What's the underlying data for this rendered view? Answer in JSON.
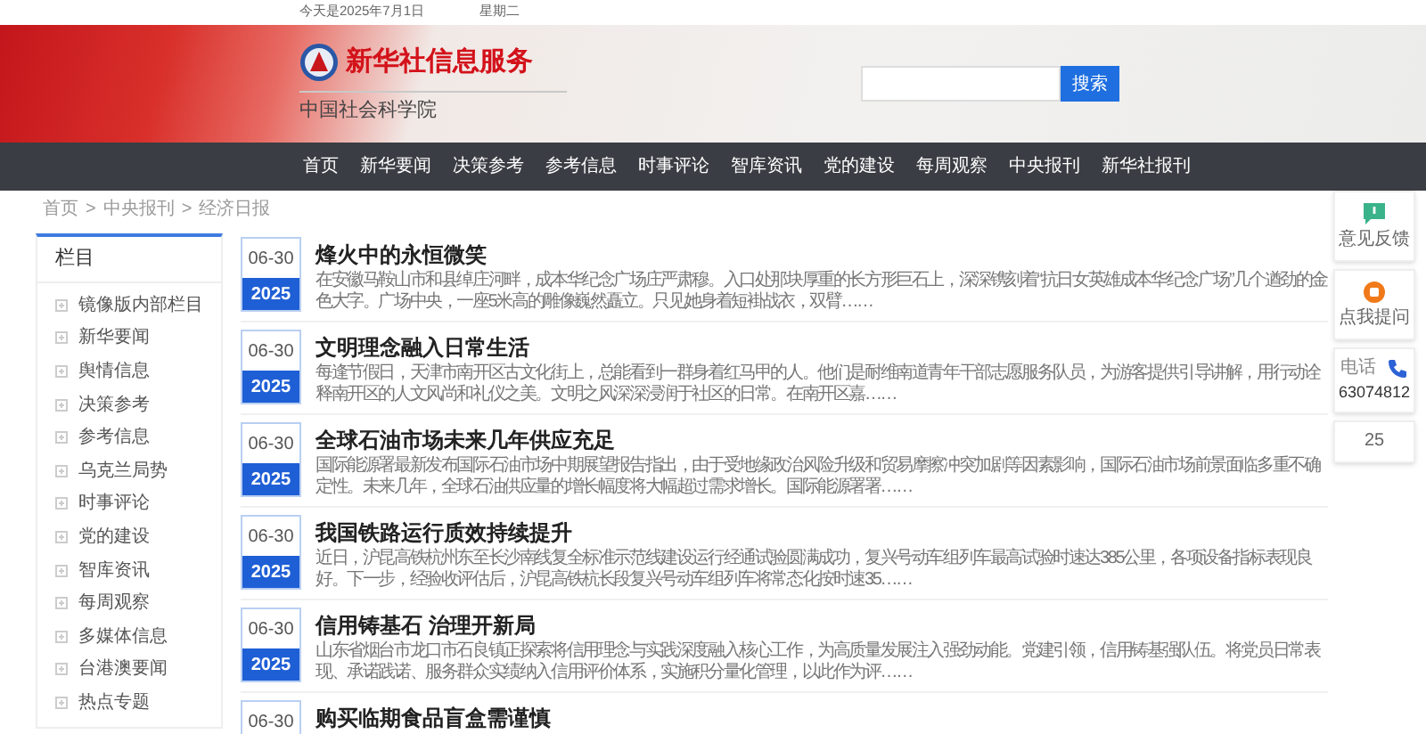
{
  "top_bar": {
    "date": "今天是2025年7月1日",
    "weekday": "星期二"
  },
  "header": {
    "brand": "新华社信息服务",
    "org": "中国社会科学院",
    "search": {
      "button": "搜索"
    }
  },
  "nav": [
    "首页",
    "新华要闻",
    "决策参考",
    "参考信息",
    "时事评论",
    "智库资讯",
    "党的建设",
    "每周观察",
    "中央报刊",
    "新华社报刊"
  ],
  "breadcrumb": {
    "separator": ">",
    "items": [
      "首页",
      "中央报刊",
      "经济日报"
    ]
  },
  "sidebar": {
    "title": "栏目",
    "items": [
      "镜像版内部栏目",
      "新华要闻",
      "舆情信息",
      "决策参考",
      "参考信息",
      "乌克兰局势",
      "时事评论",
      "党的建设",
      "智库资讯",
      "每周观察",
      "多媒体信息",
      "台港澳要闻",
      "热点专题"
    ]
  },
  "articles": [
    {
      "date": "06-30",
      "year": "2025",
      "title": "烽火中的永恒微笑",
      "summary": "在安徽马鞍山市和县绰庄河畔，成本华纪念广场庄严肃穆。入口处那块厚重的长方形巨石上，深深镌刻着“抗日女英雄成本华纪念广场”几个遒劲的金色大字。广场中央，一座5米高的雕像巍然矗立。只见她身着短褂战衣，双臂……"
    },
    {
      "date": "06-30",
      "year": "2025",
      "title": "文明理念融入日常生活",
      "summary": "每逢节假日，天津市南开区古文化街上，总能看到一群身着红马甲的人。他们是耐维南道青年干部志愿服务队员，为游客提供引导讲解，用行动诠释南开区的人文风尚和礼仪之美。文明之风深深浸润于社区的日常。在南开区嘉……"
    },
    {
      "date": "06-30",
      "year": "2025",
      "title": "全球石油市场未来几年供应充足",
      "summary": "国际能源署最新发布国际石油市场中期展望报告指出，由于受地缘政治风险升级和贸易摩擦冲突加剧等因素影响，国际石油市场前景面临多重不确定性。未来几年，全球石油供应量的增长幅度将大幅超过需求增长。国际能源署署……"
    },
    {
      "date": "06-30",
      "year": "2025",
      "title": "我国铁路运行质效持续提升",
      "summary": "近日，沪昆高铁杭州东至长沙南线复全标准示范线建设运行经通试验圆满成功，复兴号动车组列车最高试验时速达385公里，各项设备指标表现良好。下一步，经验收评估后，沪昆高铁杭长段复兴号动车组列车将常态化按时速35……"
    },
    {
      "date": "06-30",
      "year": "2025",
      "title": "信用铸基石 治理开新局",
      "summary": "山东省烟台市龙口市石良镇正探索将信用理念与实践深度融入核心工作，为高质量发展注入强劲动能。党建引领，信用铸基强队伍。将党员日常表现、承诺践诺、服务群众实绩纳入信用评价体系，实施积分量化管理，以此作为评……"
    },
    {
      "date": "06-30",
      "title": "购买临期食品盲盒需谨慎"
    }
  ],
  "float_tools": [
    {
      "kind": "feedback",
      "label": "意见反馈"
    },
    {
      "kind": "ask",
      "label": "点我提问"
    },
    {
      "kind": "phone",
      "label": "电话",
      "number": "63074812"
    },
    {
      "kind": "count",
      "label": "25"
    }
  ]
}
